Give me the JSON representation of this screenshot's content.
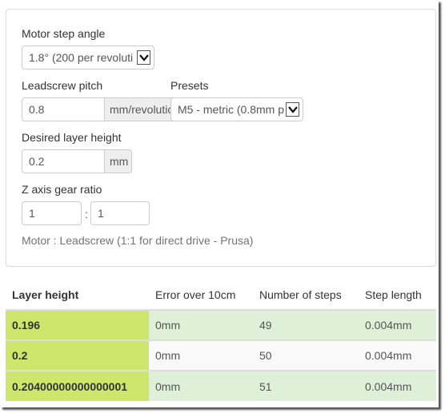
{
  "form": {
    "motor_step_angle": {
      "label": "Motor step angle",
      "value": "1.8° (200 per revoluti"
    },
    "leadscrew_pitch": {
      "label": "Leadscrew pitch",
      "value": "0.8",
      "unit": "mm/revolutic"
    },
    "presets": {
      "label": "Presets",
      "value": "M5 - metric (0.8mm p"
    },
    "layer_height": {
      "label": "Desired layer height",
      "value": "0.2",
      "unit": "mm"
    },
    "gear_ratio": {
      "label": "Z axis gear ratio",
      "motor": "1",
      "separator": ":",
      "leadscrew": "1",
      "help": "Motor : Leadscrew (1:1 for direct drive - Prusa)"
    }
  },
  "table": {
    "headers": [
      "Layer height",
      "Error over 10cm",
      "Number of steps",
      "Step length"
    ],
    "rows": [
      [
        "0.196",
        "0mm",
        "49",
        "0.004mm"
      ],
      [
        "0.2",
        "0mm",
        "50",
        "0.004mm"
      ],
      [
        "0.20400000000000001",
        "0mm",
        "51",
        "0.004mm"
      ]
    ]
  },
  "colors": {
    "highlight": "#cee66c",
    "success": "#dff0d8",
    "neutral": "#f9f9f9"
  }
}
